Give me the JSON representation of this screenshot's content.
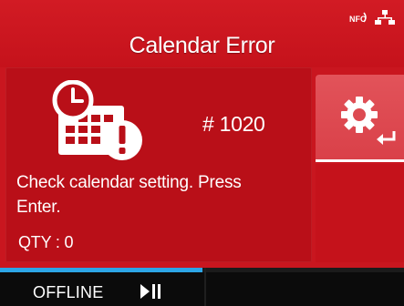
{
  "header": {
    "title": "Calendar Error",
    "status_icons": [
      "nfc-icon",
      "network-icon"
    ]
  },
  "error": {
    "icon": "calendar-clock-warning-icon",
    "code": "# 1020",
    "message": "Check calendar setting. Press Enter.",
    "qty": "QTY : 0"
  },
  "settings_button": {
    "icon": "gear-icon",
    "sub_icon": "enter-icon"
  },
  "footer": {
    "status": "OFFLINE",
    "mode_icon": "play-pause-icon",
    "progress": 0.5
  },
  "colors": {
    "background": "#c9161f",
    "panel": "#b90f18",
    "settings_button": "#e2535a",
    "progress": "#2da6e6",
    "bottom_bar": "#0b0b0b"
  }
}
